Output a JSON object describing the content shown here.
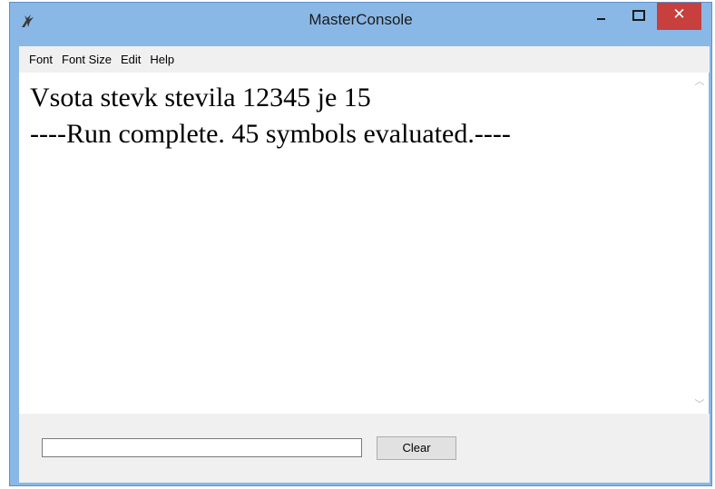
{
  "window": {
    "title": "MasterConsole",
    "minimize_glyph": "–",
    "maximize_glyph": "□",
    "close_glyph": "✕",
    "close_color": "#c7403d",
    "frame_color": "#8ab8e6"
  },
  "menubar": {
    "items": [
      "Font",
      "Font Size",
      "Edit",
      "Help"
    ]
  },
  "output": {
    "lines": [
      "Vsota stevk stevila 12345 je 15",
      "----Run complete.  45 symbols evaluated.----"
    ]
  },
  "input": {
    "value": ""
  },
  "buttons": {
    "clear_label": "Clear"
  },
  "icons": {
    "app": "raptor-icon",
    "scroll_up": "chevron-up-icon",
    "scroll_down": "chevron-down-icon"
  }
}
